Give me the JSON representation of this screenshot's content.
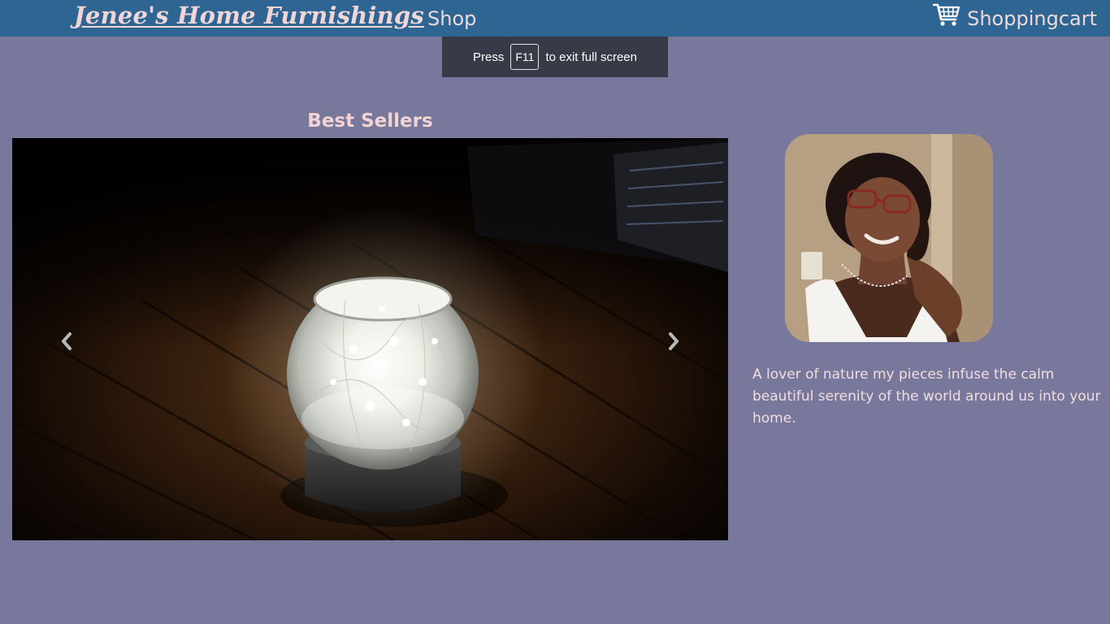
{
  "navbar": {
    "brand": "Jenee's Home Furnishings",
    "shop_label": "Shop",
    "cart_label": "Shoppingcart",
    "cart_icon": "shopping-cart-icon"
  },
  "fullscreen_notice": {
    "prefix": "Press",
    "key": "F11",
    "suffix": "to exit full screen"
  },
  "best_sellers": {
    "title": "Best Sellers",
    "prev_icon": "chevron-left-icon",
    "next_icon": "chevron-right-icon"
  },
  "about": {
    "bio": "A lover of nature my pieces infuse the calm beautiful serenity of the world around us into your home."
  },
  "colors": {
    "page_background": "#78789c",
    "navbar_background": "#2e6593",
    "accent_text": "#f2d3d3"
  }
}
